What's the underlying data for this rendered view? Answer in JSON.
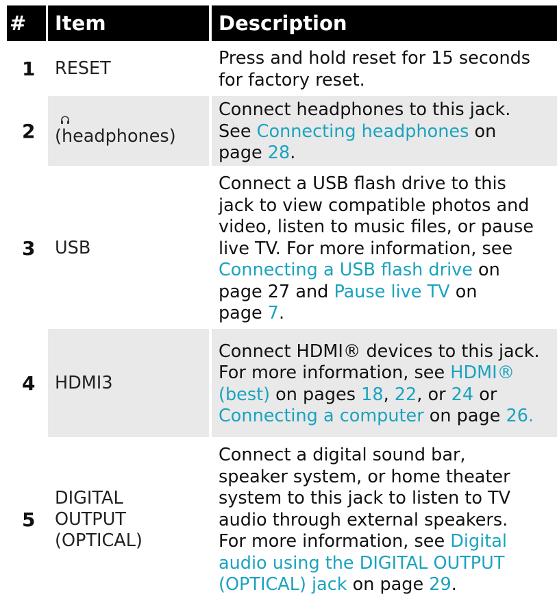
{
  "header": {
    "num": "#",
    "item": "Item",
    "description": "Description"
  },
  "rows": [
    {
      "num": "1",
      "item": "RESET",
      "lines": [
        [
          {
            "t": "Press and hold reset for 15 seconds"
          }
        ],
        [
          {
            "t": "for factory reset."
          }
        ]
      ]
    },
    {
      "num": "2",
      "icon": "headphones-icon",
      "item": "(headphones)",
      "lines": [
        [
          {
            "t": "Connect headphones to this jack."
          }
        ],
        [
          {
            "t": "See "
          },
          {
            "t": "Connecting headphones",
            "link": true
          },
          {
            "t": " on"
          }
        ],
        [
          {
            "t": "page "
          },
          {
            "t": "28",
            "link": true
          },
          {
            "t": "."
          }
        ]
      ]
    },
    {
      "num": "3",
      "item": "USB",
      "lines": [
        [
          {
            "t": "Connect a USB flash drive to this"
          }
        ],
        [
          {
            "t": "jack to view compatible photos and"
          }
        ],
        [
          {
            "t": "video, listen to music files, or pause"
          }
        ],
        [
          {
            "t": "live TV. For more information, see"
          }
        ],
        [
          {
            "t": "Connecting a USB flash drive",
            "link": true
          },
          {
            "t": " on"
          }
        ],
        [
          {
            "t": "page 27 and "
          },
          {
            "t": "Pause live TV",
            "link": true
          },
          {
            "t": " on"
          }
        ],
        [
          {
            "t": "page "
          },
          {
            "t": "7",
            "link": true
          },
          {
            "t": "."
          }
        ]
      ]
    },
    {
      "num": "4",
      "item": "HDMI3",
      "lines": [
        [
          {
            "t": "Connect HDMI® devices to this jack."
          }
        ],
        [
          {
            "t": "For more information, see "
          },
          {
            "t": "HDMI®",
            "link": true
          }
        ],
        [
          {
            "t": "(best)",
            "link": true
          },
          {
            "t": " on pages "
          },
          {
            "t": "18",
            "link": true
          },
          {
            "t": ", "
          },
          {
            "t": "22",
            "link": true
          },
          {
            "t": ", or "
          },
          {
            "t": "24",
            "link": true
          },
          {
            "t": " or"
          }
        ],
        [
          {
            "t": "Connecting a computer",
            "link": true
          },
          {
            "t": " on page "
          },
          {
            "t": "26.",
            "link": true
          }
        ]
      ]
    },
    {
      "num": "5",
      "item": "DIGITAL OUTPUT (OPTICAL)",
      "item_lines": [
        "DIGITAL",
        "OUTPUT",
        "(OPTICAL)"
      ],
      "lines": [
        [
          {
            "t": "Connect a digital sound bar,"
          }
        ],
        [
          {
            "t": "speaker system, or home theater"
          }
        ],
        [
          {
            "t": "system to this jack to listen to TV"
          }
        ],
        [
          {
            "t": "audio through external speakers."
          }
        ],
        [
          {
            "t": "For more information, see "
          },
          {
            "t": "Digital",
            "link": true
          }
        ],
        [
          {
            "t": "audio using the DIGITAL OUTPUT",
            "link": true
          }
        ],
        [
          {
            "t": "(OPTICAL) jack",
            "link": true
          },
          {
            "t": " on page "
          },
          {
            "t": "29",
            "link": true
          },
          {
            "t": "."
          }
        ]
      ]
    }
  ]
}
